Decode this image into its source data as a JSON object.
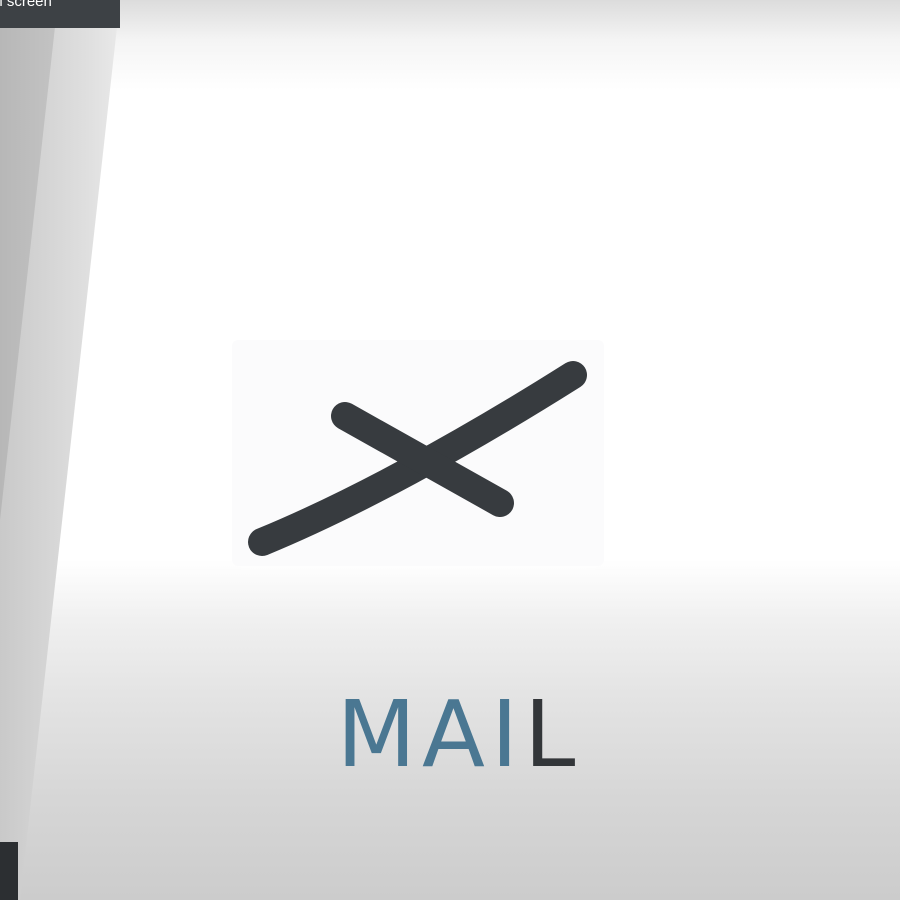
{
  "overlay": {
    "tooltip_text": "ll screen"
  },
  "logo": {
    "icon_name": "x-cross-icon",
    "icon_color": "#373b3f",
    "wordmark_main": "MAI",
    "wordmark_end": "L",
    "wordmark_main_color": "#4a7792",
    "wordmark_end_color": "#333639"
  }
}
